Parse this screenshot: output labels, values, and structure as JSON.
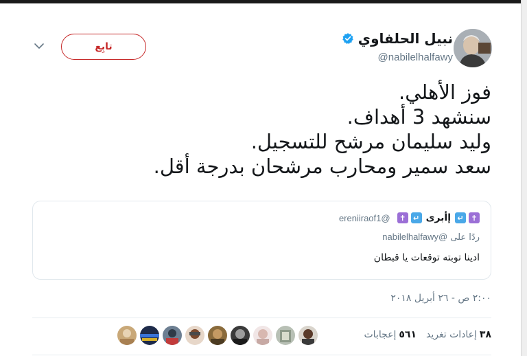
{
  "tweet": {
    "author_name": "نبيل الحلفاوي",
    "author_handle": "@nabilelhalfawy",
    "follow_label": "تابِع",
    "lines": [
      "فوز الأهلي.",
      "سنشهد 3 أهداف.",
      "وليد سليمان مرشح للتسجيل.",
      "سعد سمير ومحارب مرشحان بدرجة أقل."
    ],
    "timestamp": "٢:٠٠ ص - ٢٦ أبريل ٢٠١٨",
    "retweets_count": "٣٨",
    "retweets_label": "إعادات تغريد",
    "likes_count": "٥٦١",
    "likes_label": "إعجابات"
  },
  "quoted": {
    "name": "إأبرى",
    "handle": "@ereniiraof1",
    "reply_prefix": "ردًا على",
    "reply_handle": "@nabilelhalfawy",
    "text": "ادينا توبته توقعات يا قبطان",
    "emoji_icons": [
      "latin-cross-icon",
      "return-arrow-icon",
      "latin-cross-icon",
      "return-arrow-icon",
      "latin-cross-icon"
    ]
  },
  "colors": {
    "follow_accent": "#c62828",
    "verified": "#1da1f2",
    "muted_text": "#657786",
    "emoji_purple": "#9b6fd6",
    "emoji_blue": "#4aa8e8"
  },
  "icons": {
    "verified": "verified-badge-icon",
    "caret": "chevron-down-icon"
  },
  "liker_avatar_count": 10
}
